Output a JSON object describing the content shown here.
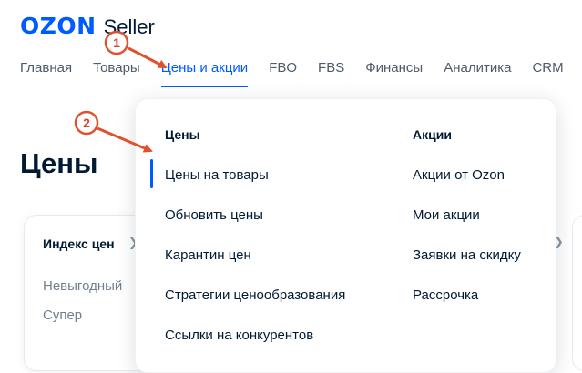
{
  "logo": {
    "brand": "OZON",
    "product": "Seller"
  },
  "nav": {
    "items": [
      "Главная",
      "Товары",
      "Цены и акции",
      "FBO",
      "FBS",
      "Финансы",
      "Аналитика",
      "CRM"
    ],
    "active_index": 2
  },
  "page": {
    "title": "Цены"
  },
  "card": {
    "title": "Индекс цен",
    "rows": [
      "Невыгодный",
      "Супер"
    ]
  },
  "dropdown": {
    "left": {
      "heading": "Цены",
      "items": [
        "Цены на товары",
        "Обновить цены",
        "Карантин цен",
        "Стратегии ценообразования",
        "Ссылки на конкурентов"
      ]
    },
    "right": {
      "heading": "Акции",
      "items": [
        "Акции от Ozon",
        "Мои акции",
        "Заявки на скидку",
        "Рассрочка"
      ]
    },
    "active_item": "Цены на товары"
  },
  "annotations": {
    "badge1": "1",
    "badge2": "2"
  },
  "colors": {
    "accent": "#005bff",
    "annotation": "#e0522f",
    "text": "#001a34"
  }
}
